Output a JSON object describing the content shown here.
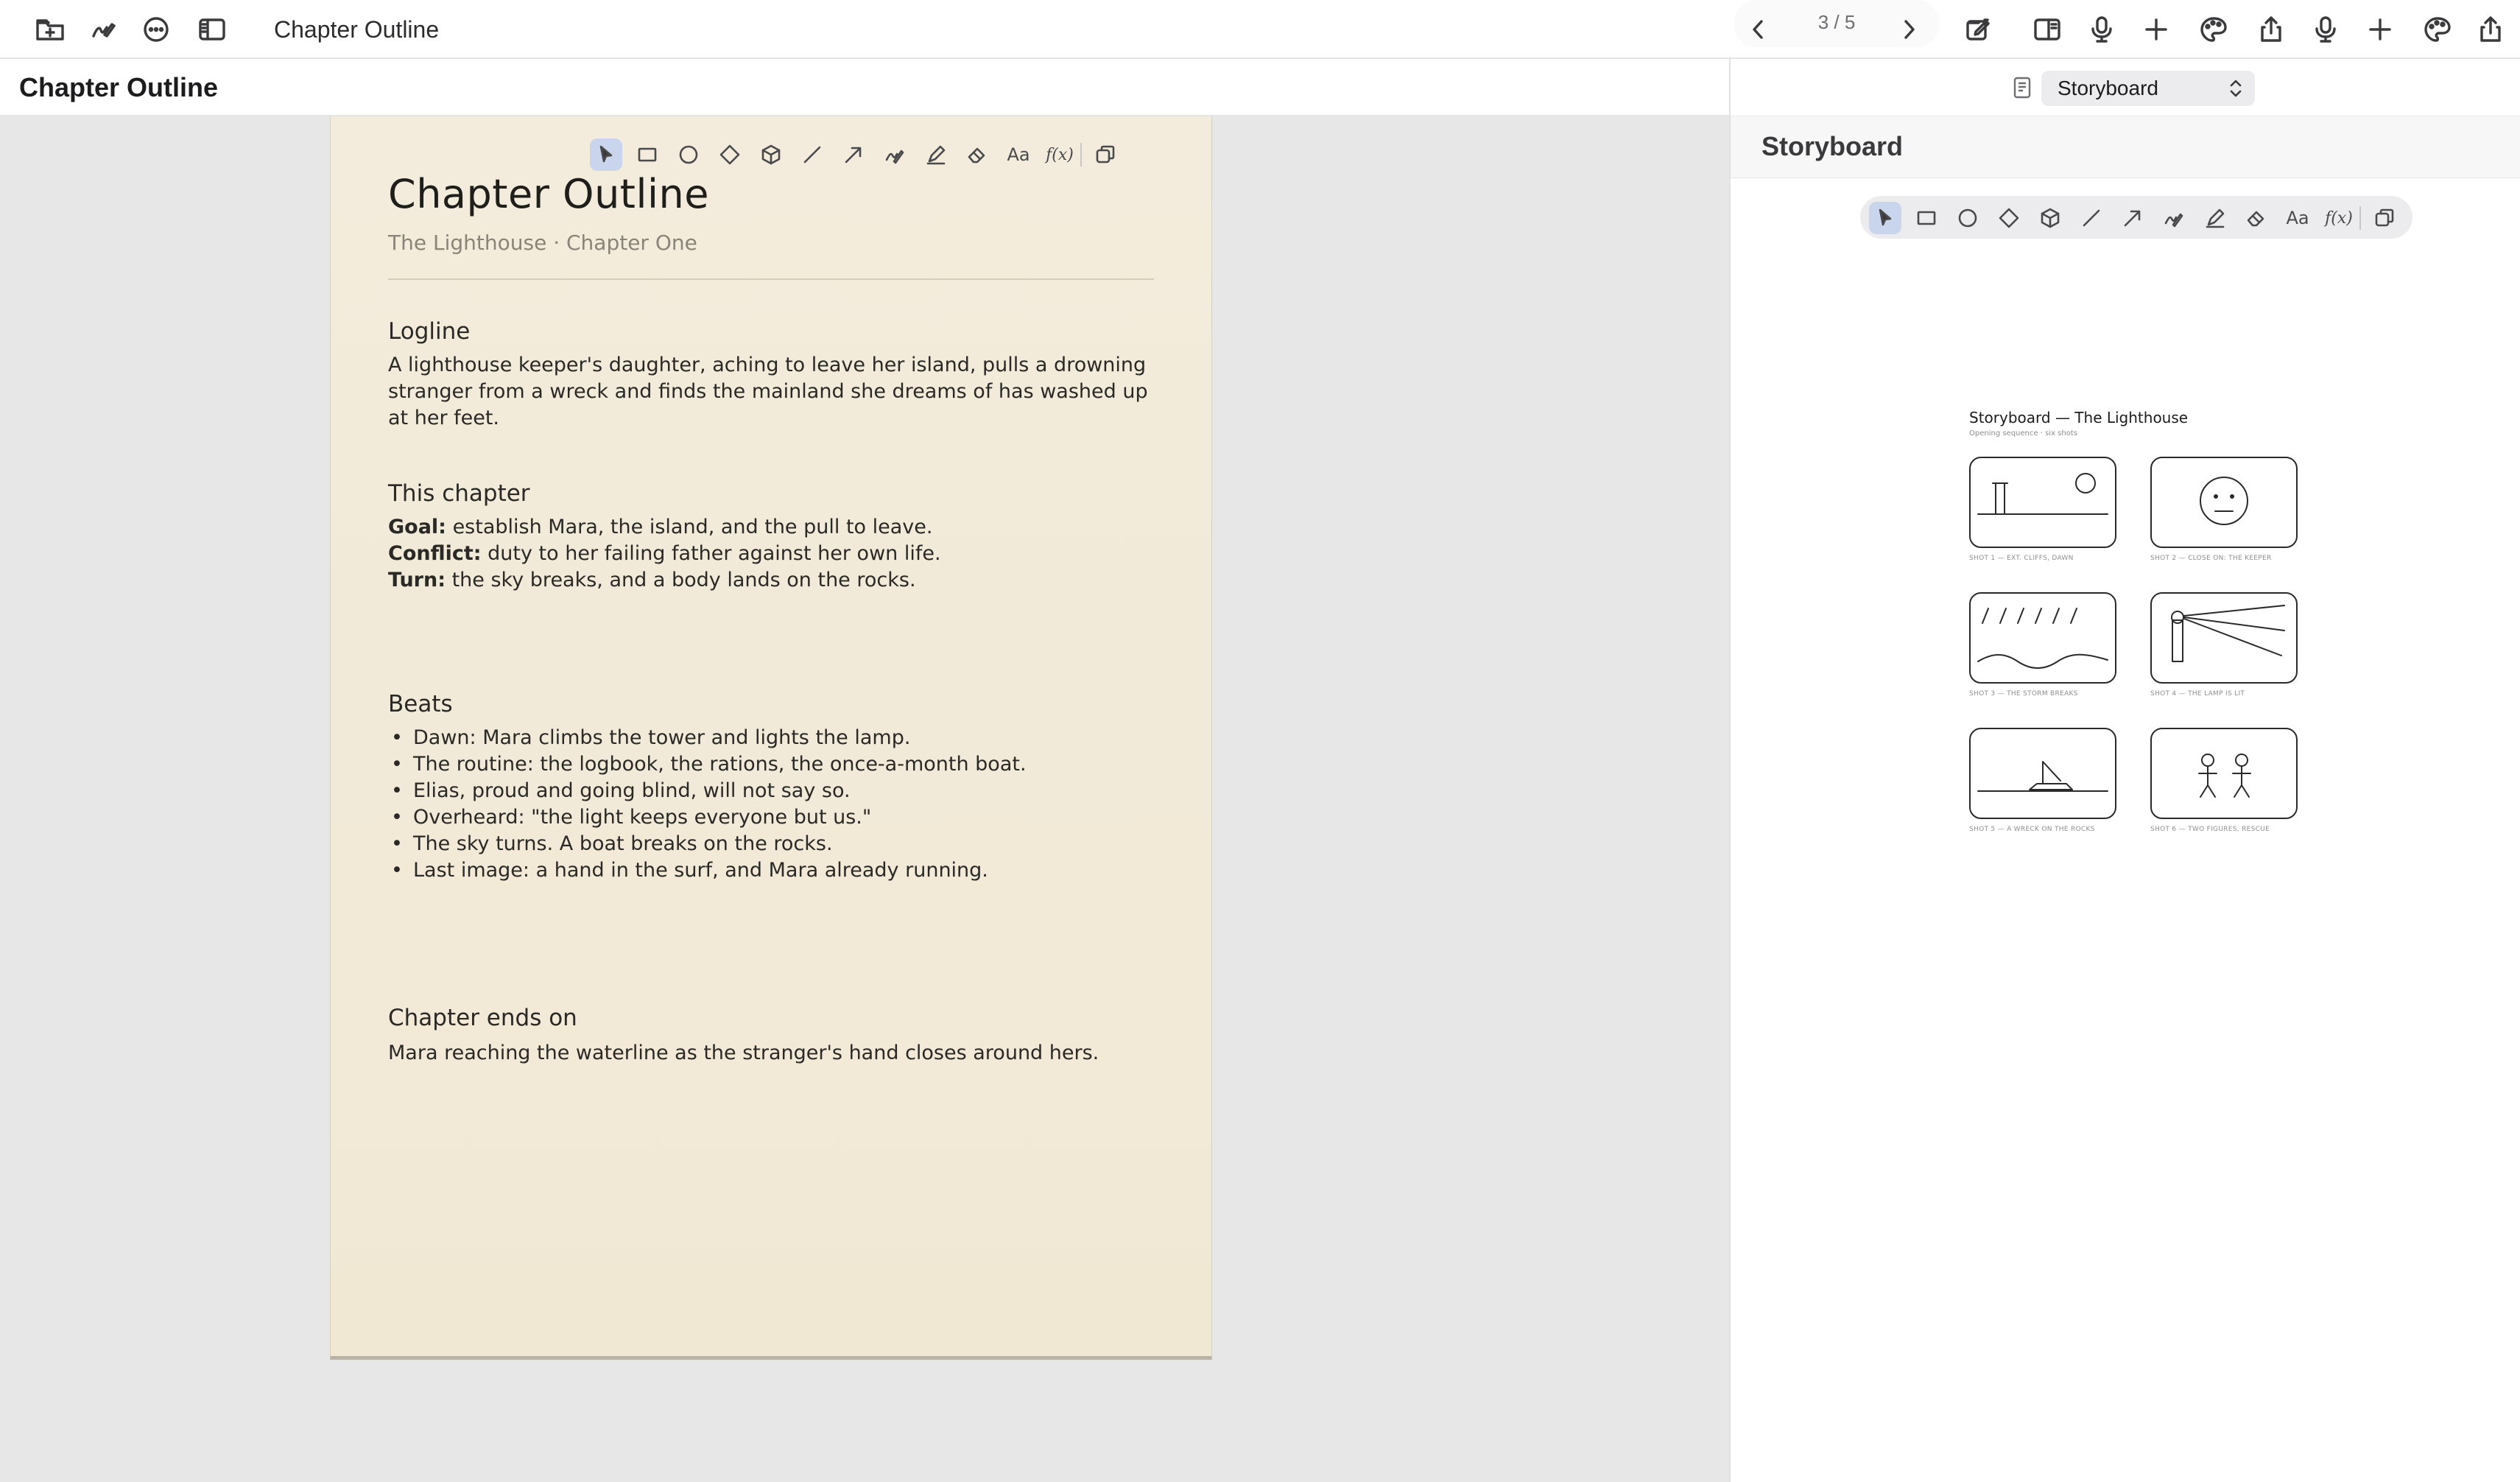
{
  "toolbar": {
    "title": "Chapter Outline",
    "page_indicator": "3 / 5",
    "left_icons": [
      "new-folder-icon",
      "scribble-pen-icon",
      "more-icon",
      "sidebar-icon"
    ],
    "right_icons": [
      "compose-icon",
      "split-view-icon",
      "microphone-icon",
      "plus-icon",
      "palette-icon",
      "share-icon",
      "microphone-icon",
      "plus-icon",
      "palette-icon",
      "share-icon"
    ]
  },
  "left_pane": {
    "header_title": "Chapter Outline",
    "paper": {
      "title": "Chapter Outline",
      "subtitle": "The Lighthouse · Chapter One",
      "logline_heading": "Logline",
      "logline_text": "A lighthouse keeper's daughter, aching to leave her island, pulls a drowning stranger from a wreck and finds the mainland she dreams of has washed up at her feet.",
      "chapter_heading": "This chapter",
      "goal_label": "Goal:",
      "goal_text": " establish Mara, the island, and the pull to leave.",
      "conflict_label": "Conflict:",
      "conflict_text": " duty to her failing father against her own life.",
      "turn_label": "Turn:",
      "turn_text": " the sky breaks, and a body lands on the rocks.",
      "beats_heading": "Beats",
      "beats": [
        "Dawn: Mara climbs the tower and lights the lamp.",
        "The routine: the logbook, the rations, the once-a-month boat.",
        "Elias, proud and going blind, will not say so.",
        "Overheard: \"the light keeps everyone but us.\"",
        "The sky turns. A boat breaks on the rocks.",
        "Last image: a hand in the surf, and Mara already running."
      ],
      "ends_heading": "Chapter ends on",
      "ends_text": "Mara reaching the waterline as the stranger's hand closes around hers."
    }
  },
  "drawing_toolbar": {
    "tools": [
      "select-pointer",
      "rectangle",
      "ellipse",
      "diamond",
      "cube",
      "line",
      "arrow",
      "scribble",
      "pen",
      "eraser",
      "text",
      "formula",
      "duplicate"
    ],
    "active": "select-pointer",
    "text_tool_label": "Aa",
    "formula_tool_label": "f(x)"
  },
  "right_pane": {
    "selector_value": "Storyboard",
    "title": "Storyboard",
    "storyboard": {
      "title": "Storyboard — The Lighthouse",
      "subtitle": "Opening sequence · six shots",
      "shots": [
        "SHOT 1 — EXT. CLIFFS, DAWN",
        "SHOT 2 — CLOSE ON: THE KEEPER",
        "SHOT 3 — THE STORM BREAKS",
        "SHOT 4 — THE LAMP IS LIT",
        "SHOT 5 — A WRECK ON THE ROCKS",
        "SHOT 6 — TWO FIGURES, RESCUE"
      ]
    }
  },
  "colors": {
    "paper": "#f2eada",
    "canvas": "#e7e7e7",
    "active_tool": "#c9d5ec",
    "ink": "#2a2926"
  }
}
